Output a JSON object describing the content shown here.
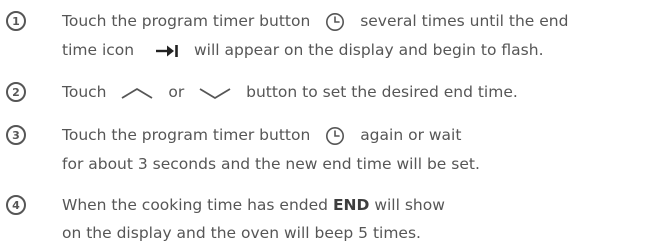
{
  "steps": [
    {
      "number": "1",
      "line1_a": "Touch the program timer button",
      "line1_b": "several times until the end",
      "line2_a": "time icon",
      "line2_b": "will appear on the display and begin to flash.",
      "icons": [
        "clock-icon",
        "end-time-arrow-icon"
      ]
    },
    {
      "number": "2",
      "line1_a": "Touch",
      "line1_b": "or",
      "line1_c": "button to set the desired end time.",
      "icons": [
        "chevron-up-icon",
        "chevron-down-icon"
      ]
    },
    {
      "number": "3",
      "line1_a": "Touch the program timer button",
      "line1_b": "again or wait",
      "line2": "for about 3 seconds and the new end time will be set.",
      "icons": [
        "clock-icon"
      ]
    },
    {
      "number": "4",
      "line1_a": "When the cooking time has ended",
      "line1_strong": "END",
      "line1_b": "will show",
      "line2": "on the display and the oven will beep 5 times."
    }
  ],
  "colors": {
    "text": "#565656",
    "emphasis": "#3e3e3e",
    "background": "#ffffff"
  }
}
